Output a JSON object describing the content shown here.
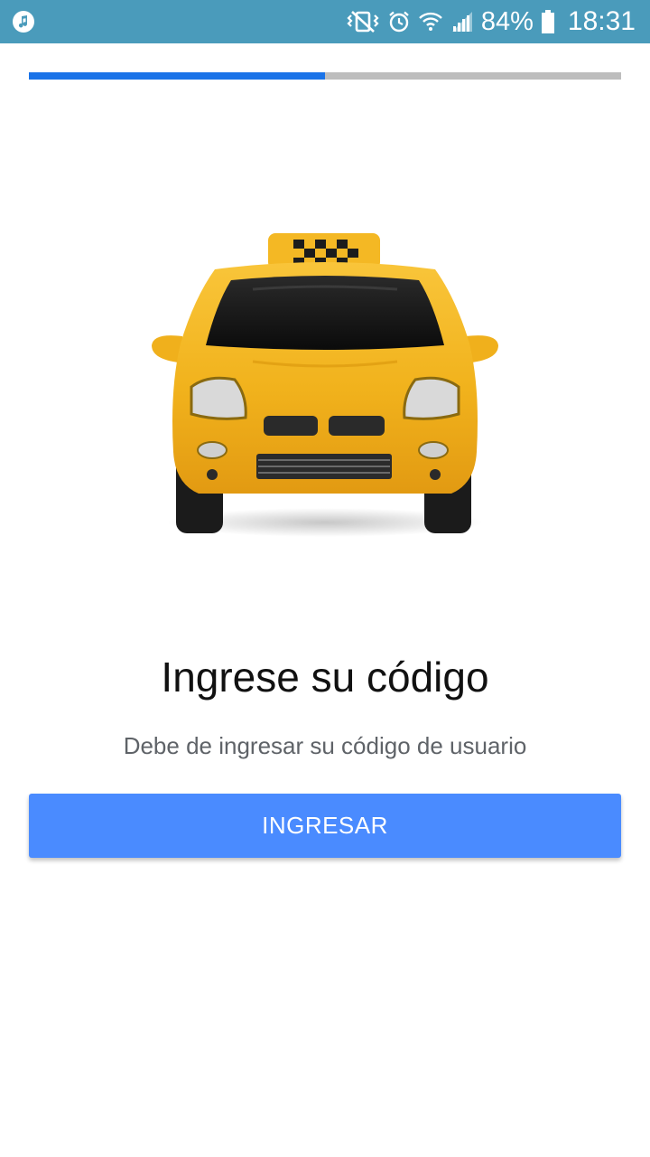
{
  "status_bar": {
    "battery_percent": "84%",
    "time": "18:31",
    "icons": [
      "music-note-icon",
      "vibrate-icon",
      "alarm-icon",
      "wifi-icon",
      "signal-icon",
      "battery-icon"
    ]
  },
  "progress": {
    "fraction": 0.5,
    "fill_color": "#1a73e8",
    "track_color": "#bdbdbd"
  },
  "hero": {
    "image": "taxi-car-image"
  },
  "content": {
    "title": "Ingrese su código",
    "subtitle": "Debe de ingresar su código de usuario"
  },
  "actions": {
    "login_label": "INGRESAR"
  },
  "colors": {
    "status_bar": "#4a9bbb",
    "button": "#4a8bff"
  }
}
